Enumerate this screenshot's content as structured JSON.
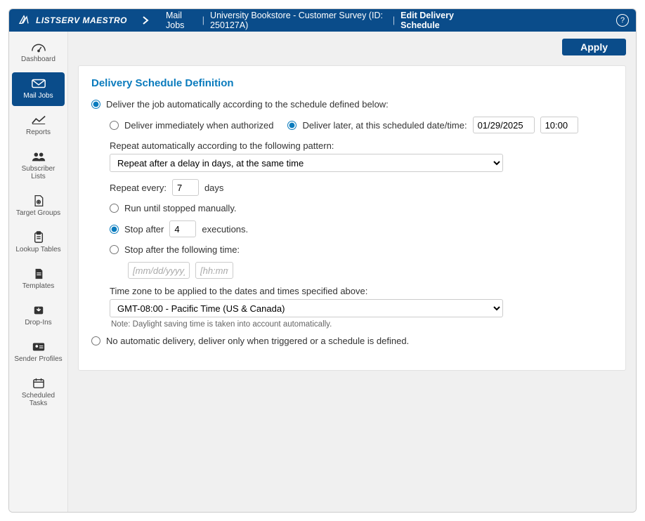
{
  "topbar": {
    "brand": "LISTSERV MAESTRO",
    "crumb_section": "Mail Jobs",
    "crumb_job": "University Bookstore - Customer Survey (ID: 250127A)",
    "crumb_page": "Edit Delivery Schedule",
    "help_glyph": "?"
  },
  "sidebar": {
    "items": [
      {
        "label": "Dashboard"
      },
      {
        "label": "Mail Jobs"
      },
      {
        "label": "Reports"
      },
      {
        "label": "Subscriber Lists"
      },
      {
        "label": "Target Groups"
      },
      {
        "label": "Lookup Tables"
      },
      {
        "label": "Templates"
      },
      {
        "label": "Drop-Ins"
      },
      {
        "label": "Sender Profiles"
      },
      {
        "label": "Scheduled Tasks"
      }
    ]
  },
  "actions": {
    "apply": "Apply"
  },
  "panel": {
    "title": "Delivery Schedule Definition",
    "opt_auto": "Deliver the job automatically according to the schedule defined below:",
    "opt_immediate": "Deliver immediately when authorized",
    "opt_later": "Deliver later, at this scheduled date/time:",
    "date_value": "01/29/2025",
    "time_value": "10:00",
    "repeat_label": "Repeat automatically according to the following pattern:",
    "repeat_pattern_selected": "Repeat after a delay in days, at the same time",
    "repeat_every_prefix": "Repeat every:",
    "repeat_every_value": "7",
    "repeat_every_suffix": "days",
    "stop_manual": "Run until stopped manually.",
    "stop_after_prefix": "Stop after",
    "stop_after_value": "4",
    "stop_after_suffix": "executions.",
    "stop_time": "Stop after the following time:",
    "stop_date_placeholder": "[mm/dd/yyyy]",
    "stop_time_placeholder": "[hh:mm]",
    "tz_label": "Time zone to be applied to the dates and times specified above:",
    "tz_selected": "GMT-08:00 - Pacific Time (US & Canada)",
    "tz_note": "Note: Daylight saving time is taken into account automatically.",
    "opt_noauto": "No automatic delivery, deliver only when triggered or a schedule is defined."
  }
}
